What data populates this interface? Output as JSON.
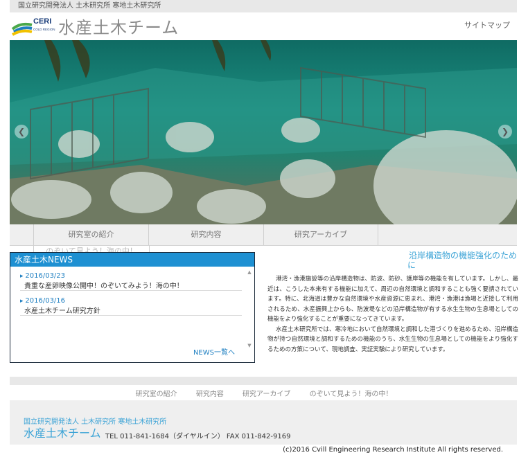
{
  "header": {
    "org_line": "国立研究開発法人 土木研究所 寒地土木研究所",
    "logo_text": "CERI",
    "logo_sub": "COLD REGION",
    "team_title": "水産土木チーム",
    "sitemap_label": "サイトマップ"
  },
  "hero": {
    "prev_icon": "chevron-left-icon",
    "next_icon": "chevron-right-icon"
  },
  "nav": {
    "items": [
      "研究室の紹介",
      "研究内容",
      "研究アーカイブ"
    ],
    "overflow_item": "のぞいて見よう！海の中！"
  },
  "news": {
    "heading": "水産土木NEWS",
    "items": [
      {
        "date": "2016/03/23",
        "title": "貴重な産卵映像公開中！のぞいてみよう！海の中！"
      },
      {
        "date": "2016/03/16",
        "title": "水産土木チーム研究方針"
      }
    ],
    "more_label": "NEWS一覧へ"
  },
  "article": {
    "title_line1": "沿岸構造物の機能強化のため",
    "title_line2": "に",
    "paragraphs": [
      "港湾・漁港施設等の沿岸構造物は、防波、防砂、護岸等の機能を有しています。しかし、最近は、こうした本来有する機能に加えて、周辺の自然環境と調和することも強く要請されています。特に、北海道は豊かな自然環境や水産資源に恵まれ、港湾・漁港は漁場と近接して利用されるため、水産振興上からも、防波堤などの沿岸構造物が有する水生生物の生息場としての機能をより強化することが重要になってきています。",
      "水産土木研究所では、寒冷地において自然環境と調和した港づくりを進めるため、沿岸構造物が持つ自然環境と調和するための機能のうち、水生生物の生息場としての機能をより強化するための方策について、現地調査、実証実験により研究しています。"
    ]
  },
  "footer": {
    "nav": [
      "研究室の紹介",
      "研究内容",
      "研究アーカイブ",
      "のぞいて見よう！海の中！"
    ],
    "org_line": "国立研究開発法人 土木研究所 寒地土木研究所",
    "team_title": "水産土木チーム",
    "contact": "TEL 011-841-1684（ダイヤルイン） FAX 011-842-9169",
    "copyright": "(c)2016 Cvill Engineering Research Institute All rights reserved."
  }
}
